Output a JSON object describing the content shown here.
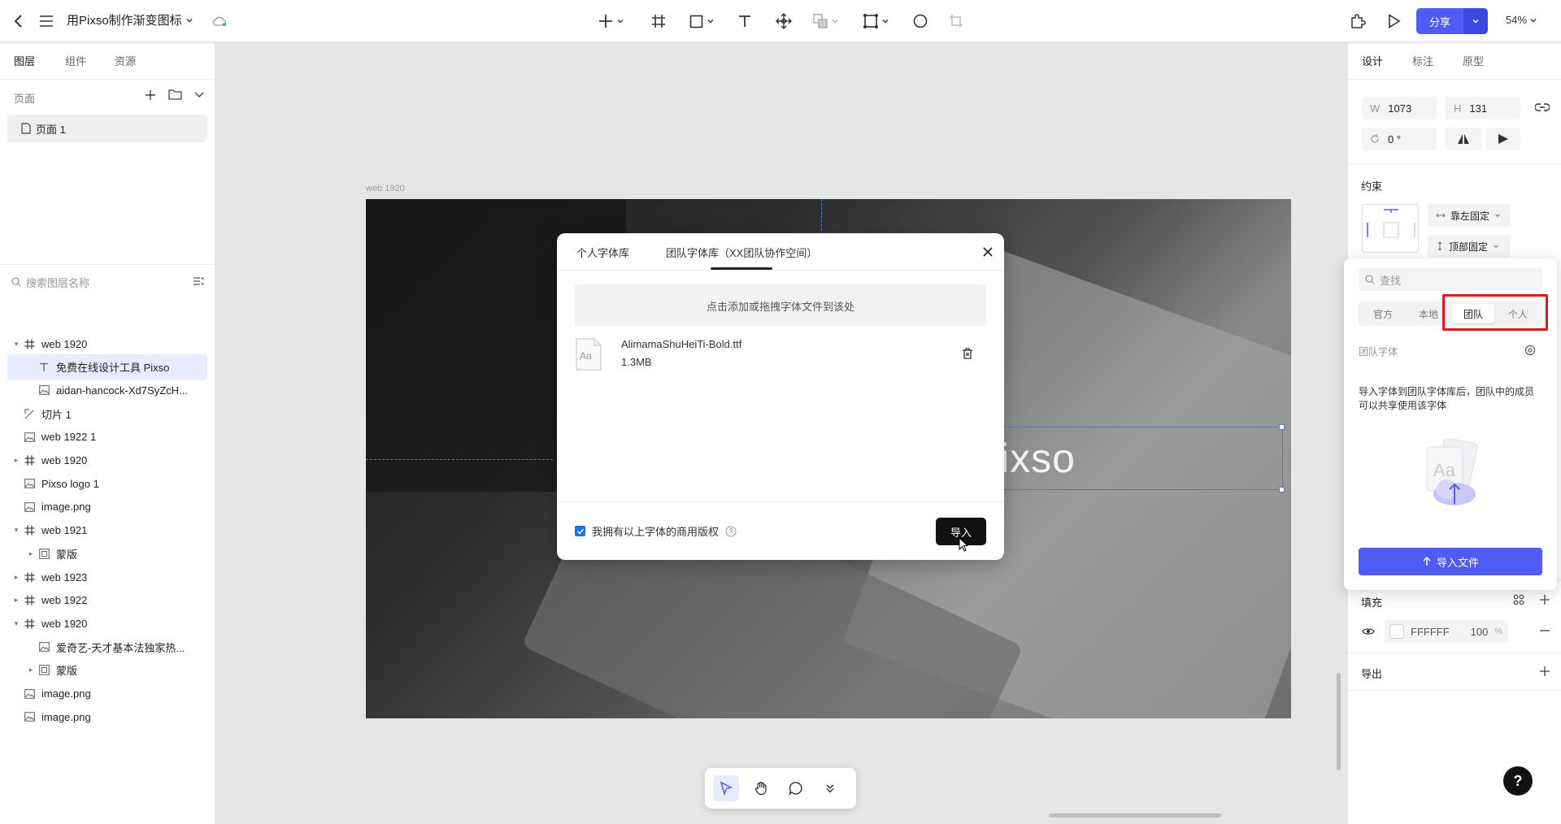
{
  "topbar": {
    "file_title": "用Pixso制作渐变图标",
    "share_label": "分享",
    "zoom": "54%"
  },
  "left_panel": {
    "tabs": [
      "图层",
      "组件",
      "资源"
    ],
    "pages_label": "页面",
    "current_page": "页面 1",
    "search_placeholder": "搜索图层名称",
    "layers": [
      {
        "name": "web 1920",
        "type": "frame",
        "expand": "open",
        "indent": 0
      },
      {
        "name": "免费在线设计工具 Pixso",
        "type": "text",
        "expand": "none",
        "indent": 1,
        "selected": true
      },
      {
        "name": "aidan-hancock-Xd7SyZcH...",
        "type": "image",
        "expand": "none",
        "indent": 1
      },
      {
        "name": "切片 1",
        "type": "slice",
        "expand": "none",
        "indent": 0
      },
      {
        "name": "web 1922 1",
        "type": "image",
        "expand": "none",
        "indent": 0
      },
      {
        "name": "web 1920",
        "type": "frame",
        "expand": "closed",
        "indent": 0
      },
      {
        "name": "Pixso logo 1",
        "type": "image",
        "expand": "none",
        "indent": 0
      },
      {
        "name": "image.png",
        "type": "image",
        "expand": "none",
        "indent": 0
      },
      {
        "name": "web 1921",
        "type": "frame",
        "expand": "open",
        "indent": 0
      },
      {
        "name": "蒙版",
        "type": "mask",
        "expand": "closed",
        "indent": 1
      },
      {
        "name": "web 1923",
        "type": "frame",
        "expand": "closed",
        "indent": 0
      },
      {
        "name": "web 1922",
        "type": "frame",
        "expand": "closed",
        "indent": 0
      },
      {
        "name": "web 1920",
        "type": "frame",
        "expand": "open",
        "indent": 0
      },
      {
        "name": "爱奇艺-天才基本法独家热...",
        "type": "image",
        "expand": "none",
        "indent": 1
      },
      {
        "name": "蒙版",
        "type": "mask",
        "expand": "closed",
        "indent": 1
      },
      {
        "name": "image.png",
        "type": "image",
        "expand": "none",
        "indent": 0
      },
      {
        "name": "image.png",
        "type": "image",
        "expand": "none",
        "indent": 0
      }
    ]
  },
  "canvas": {
    "frame_label": "web 1920",
    "canvas_text": "ixso"
  },
  "modal": {
    "tab_personal": "个人字体库",
    "tab_team": "团队字体库（XX团队协作空间）",
    "drop_zone": "点击添加或拖拽字体文件到该处",
    "file_icon_text": "Aa",
    "font_file": {
      "name": "AlimamaShuHeiTi-Bold.ttf",
      "size": "1.3MB"
    },
    "agree_text": "我拥有以上字体的商用版权",
    "import_label": "导入"
  },
  "right_panel": {
    "tabs": [
      "设计",
      "标注",
      "原型"
    ],
    "w_label": "W",
    "w_value": "1073",
    "h_label": "H",
    "h_value": "131",
    "rotation": "0 °",
    "constraints_label": "约束",
    "constraint_h": "靠左固定",
    "constraint_v": "顶部固定",
    "fill_label": "填充",
    "fill_hex": "FFFFFF",
    "fill_opacity": "100",
    "fill_unit": "%",
    "export_label": "导出"
  },
  "font_popover": {
    "search_placeholder": "查找",
    "segments": [
      "官方",
      "本地",
      "团队",
      "个人"
    ],
    "active_segment": "团队",
    "team_font_label": "团队字体",
    "description": "导入字体到团队字体库后，团队中的成员可以共享使用该字体",
    "illus_text": "Aa",
    "import_file_label": "导入文件"
  },
  "help_label": "?",
  "colors": {
    "accent": "#4f5cf5",
    "highlight_red": "#e8141b",
    "selection_blue": "#e8ecff"
  }
}
